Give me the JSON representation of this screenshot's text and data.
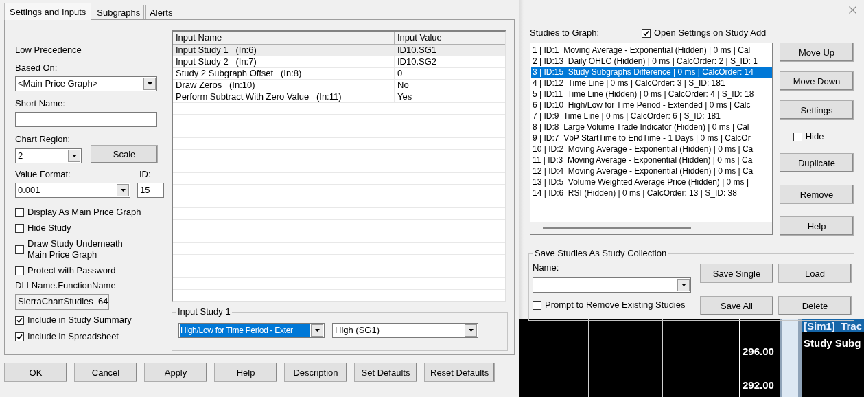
{
  "settings_dialog": {
    "tabs": [
      {
        "label": "Settings and Inputs",
        "selected": true
      },
      {
        "label": "Subgraphs",
        "selected": false
      },
      {
        "label": "Alerts",
        "selected": false
      }
    ],
    "precedence": "Low Precedence",
    "based_on": {
      "label": "Based On:",
      "value": "<Main Price Graph>"
    },
    "short_name": {
      "label": "Short Name:"
    },
    "chart_region": {
      "label": "Chart Region:",
      "value": "2"
    },
    "scale_button": "Scale",
    "value_format": {
      "label": "Value Format:",
      "value": "0.001"
    },
    "id": {
      "label": "ID:",
      "value": "15"
    },
    "options": [
      {
        "label": "Display As Main Price Graph",
        "checked": false
      },
      {
        "label": "Hide Study",
        "checked": false
      },
      {
        "label": "Draw Study Underneath\nMain Price Graph",
        "checked": false
      },
      {
        "label": "Protect with Password",
        "checked": false
      }
    ],
    "dll": {
      "label": "DLLName.FunctionName",
      "value": "SierraChartStudies_64"
    },
    "summary_options": [
      {
        "label": "Include in Study Summary",
        "checked": true
      },
      {
        "label": "Include in Spreadsheet",
        "checked": true
      }
    ],
    "inputs_table": {
      "columns": [
        "Input Name",
        "Input Value"
      ],
      "rows": [
        {
          "name": "Input Study 1   (In:6)",
          "value": "ID10.SG1",
          "selected": true
        },
        {
          "name": "Input Study 2   (In:7)",
          "value": "ID10.SG2",
          "selected": false
        },
        {
          "name": "Study 2 Subgraph Offset   (In:8)",
          "value": "0",
          "selected": false
        },
        {
          "name": "Draw Zeros   (In:10)",
          "value": "No",
          "selected": false
        },
        {
          "name": "Perform Subtract With Zero Value   (In:11)",
          "value": "Yes",
          "selected": false
        }
      ]
    },
    "input_group": {
      "title": "Input Study 1",
      "study": "High/Low for Time Period - Exter",
      "subgraph": "High (SG1)"
    },
    "buttons": [
      "OK",
      "Cancel",
      "Apply",
      "Help",
      "Description",
      "Set Defaults",
      "Reset Defaults"
    ]
  },
  "studies_dialog": {
    "list_label": "Studies to Graph:",
    "open_settings": {
      "label": "Open Settings on Study Add",
      "checked": true
    },
    "studies": [
      {
        "label": "1 | ID:1  Moving Average - Exponential (Hidden) | 0 ms | Cal",
        "selected": false
      },
      {
        "label": "2 | ID:13  Daily OHLC (Hidden) | 0 ms | CalcOrder: 2 | S_ID: 1",
        "selected": false
      },
      {
        "label": "3 | ID:15  Study Subgraphs Difference | 0 ms | CalcOrder: 14",
        "selected": true
      },
      {
        "label": "4 | ID:12  Time Line | 0 ms | CalcOrder: 3 | S_ID: 181",
        "selected": false
      },
      {
        "label": "5 | ID:11  Time Line (Hidden) | 0 ms | CalcOrder: 4 | S_ID: 18",
        "selected": false
      },
      {
        "label": "6 | ID:10  High/Low for Time Period - Extended | 0 ms | Calc",
        "selected": false
      },
      {
        "label": "7 | ID:9  Time Line | 0 ms | CalcOrder: 6 | S_ID: 181",
        "selected": false
      },
      {
        "label": "8 | ID:8  Large Volume Trade Indicator (Hidden) | 0 ms | Cal",
        "selected": false
      },
      {
        "label": "9 | ID:7  VbP StartTime to EndTime - 1 Days | 0 ms | CalcOr",
        "selected": false
      },
      {
        "label": "10 | ID:2  Moving Average - Exponential (Hidden) | 0 ms | Ca",
        "selected": false
      },
      {
        "label": "11 | ID:3  Moving Average - Exponential (Hidden) | 0 ms | Ca",
        "selected": false
      },
      {
        "label": "12 | ID:4  Moving Average - Exponential (Hidden) | 0 ms | Ca",
        "selected": false
      },
      {
        "label": "13 | ID:5  Volume Weighted Average Price (Hidden) | 0 ms |",
        "selected": false
      },
      {
        "label": "14 | ID:6  RSI (Hidden) | 0 ms | CalcOrder: 13 | S_ID: 38",
        "selected": false
      }
    ],
    "side_buttons": [
      "Move Up",
      "Move Down",
      "Settings"
    ],
    "hide": {
      "label": "Hide",
      "checked": false
    },
    "side_buttons_2": [
      "Duplicate",
      "Remove",
      "Help"
    ],
    "collection": {
      "title": "Save Studies As Study Collection",
      "name_label": "Name:",
      "prompt": {
        "label": "Prompt to Remove Existing Studies",
        "checked": false
      },
      "buttons": [
        "Save Single",
        "Load",
        "Save All",
        "Delete"
      ]
    }
  },
  "chart": {
    "trade_header": "[Sim1]  Trac",
    "panel_text": "Study Subg",
    "price_labels": [
      "296.00",
      "292.00"
    ]
  }
}
